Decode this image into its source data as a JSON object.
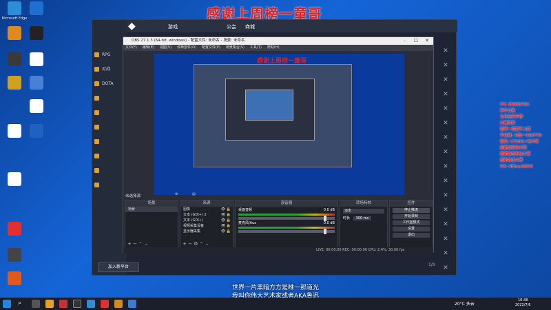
{
  "banner": "感谢上周榜一童哥",
  "desktop_icons": [
    {
      "label": "Microsoft Edge",
      "color": "#2b8fd8"
    },
    {
      "label": "",
      "color": "#1e6fd0"
    },
    {
      "label": "",
      "color": "#e08a1e"
    },
    {
      "label": "",
      "color": "#222"
    },
    {
      "label": "",
      "color": "#3a3a3a"
    },
    {
      "label": "",
      "color": "#ffffff"
    },
    {
      "label": "",
      "color": "#d0a020"
    },
    {
      "label": "",
      "color": "#4a7fd8"
    },
    {
      "label": "",
      "color": "#ffffff"
    },
    {
      "label": "",
      "color": "#ffffff"
    },
    {
      "label": "",
      "color": "#2060c0"
    },
    {
      "label": "",
      "color": "#ffffff"
    },
    {
      "label": "",
      "color": "#e03030"
    },
    {
      "label": "",
      "color": "#444"
    },
    {
      "label": "",
      "color": "#e05a1e"
    }
  ],
  "client": {
    "tabs": [
      "游戏",
      "",
      "公会",
      "商城"
    ],
    "side_items": [
      "RPG",
      "对战",
      "DOTA",
      "",
      "",
      "",
      "",
      "",
      "",
      ""
    ],
    "bottom_button": "加入新平台",
    "pager": "1/9"
  },
  "obs": {
    "title": "OBS 27.1.3 (64-bit, windows) - 配置文件: 未命名 - 场景: 未命名",
    "menu": [
      "文件(F)",
      "编辑(E)",
      "视图(V)",
      "停靠部件(D)",
      "配置文件(P)",
      "场景集合(S)",
      "工具(T)",
      "帮助(H)"
    ],
    "preview_banner": "感谢上周榜一童哥",
    "no_source": "未选择源",
    "scenes_header": "场景",
    "scene_item": "场景",
    "sources_header": "来源",
    "sources": [
      "图像",
      "文本 (GDI+) 2",
      "文本 (GDI+)",
      "视频采集设备",
      "显示器采集"
    ],
    "mixer_header": "混音器",
    "mixer_channels": [
      {
        "name": "桌面音频",
        "db": "0.0 dB"
      },
      {
        "name": "麦克风/Aux",
        "db": "0.0 dB"
      }
    ],
    "transition_header": "转场特效",
    "transition_type": "淡出",
    "transition_duration_label": "时长",
    "transition_duration": "300 ms",
    "controls_header": "控件",
    "controls": [
      "停止推流",
      "开始录制",
      "工作室模式",
      "设置",
      "退出"
    ],
    "status": "LIVE: 00:00:00   REC: 00:00:00   CPU: 2.4%, 30.00 fps"
  },
  "right_text": [
    "YY: 38058716",
    "关于公告",
    "七月全天不停",
    "大量收单",
    "钢琴一直播不上播",
    "平台播: 斗鱼一928770",
    "吸引: C7985+电子城",
    "感谢支持的大哥",
    "感谢每位粉丝大哥",
    "感谢各位大哥",
    "VX: 8Bhan8834"
  ],
  "subtitles": [
    "世界一片黑暗方方是唯一那道光",
    "我叫你伟大艺术家或者AKA鲁迅"
  ],
  "taskbar": {
    "weather": "20°C 多云",
    "time": "18:38",
    "date": "2022/7/6"
  }
}
